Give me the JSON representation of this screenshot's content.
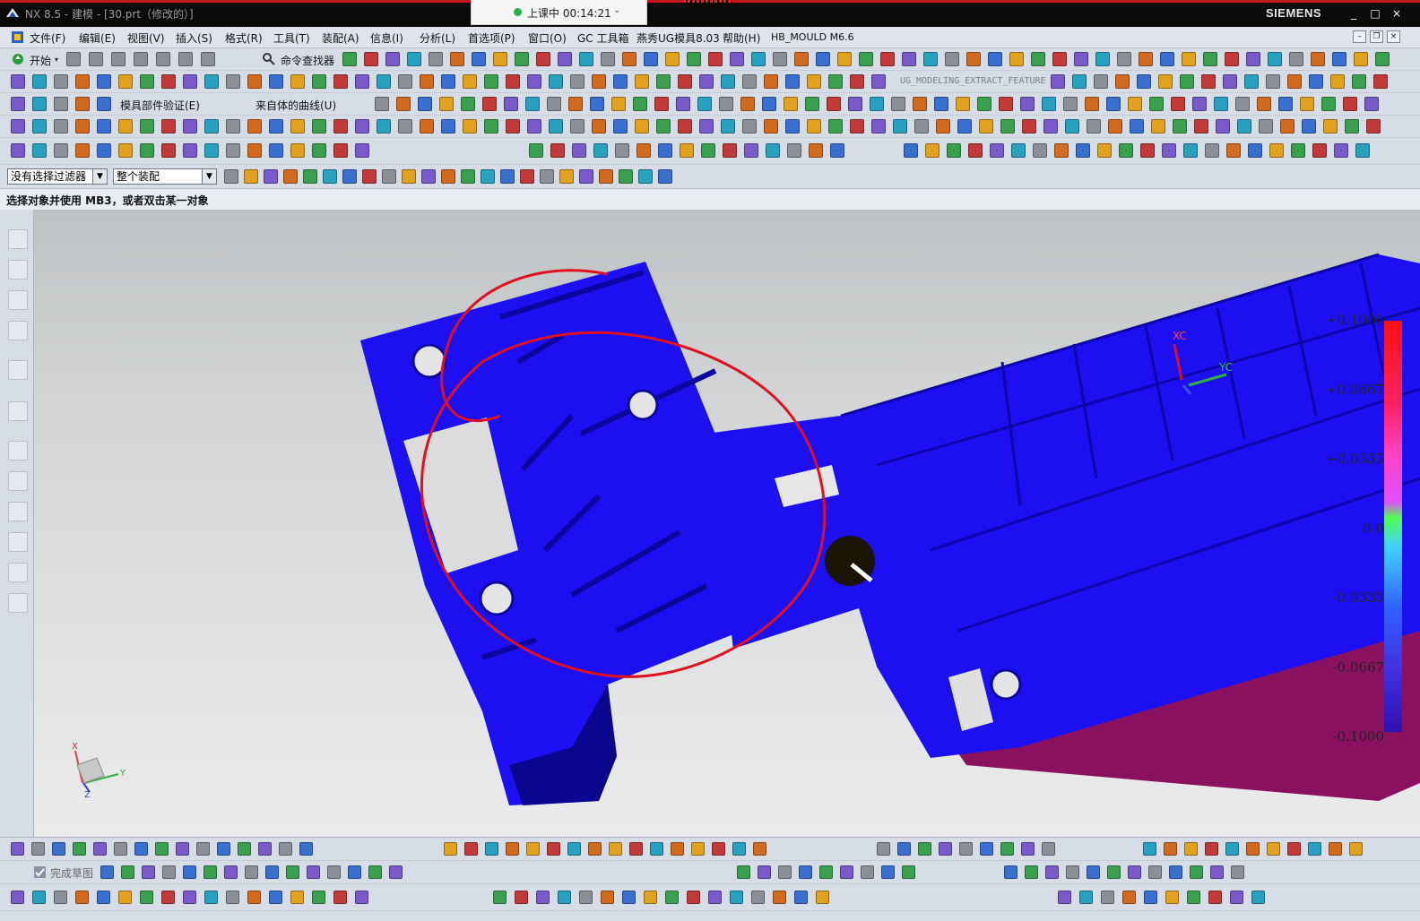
{
  "window": {
    "title": "NX 8.5 - 建模 - [30.prt（修改的）]",
    "brand": "SIEMENS",
    "controls": [
      "_",
      "□",
      "×"
    ]
  },
  "session_overlay": {
    "status": "上课中 00:14:21",
    "chevron": "⌄"
  },
  "menubar": {
    "items": [
      "文件(F)",
      "编辑(E)",
      "视图(V)",
      "插入(S)",
      "格式(R)",
      "工具(T)",
      "装配(A)",
      "信息(I)",
      "分析(L)",
      "首选项(P)",
      "窗口(O)",
      "GC 工具箱",
      "燕秀UG模具8.03",
      "帮助(H)",
      "HB_MOULD M6.6"
    ],
    "mdi_controls": [
      "–",
      "❐",
      "×"
    ]
  },
  "toolbar": {
    "start_label": "开始",
    "command_finder_label": "命令查找器",
    "extract_feature_label": "UG_MODELING_EXTRACT_FEATURE",
    "mold_validation_label": "模具部件验证(E)",
    "curves_from_bodies_label": "来自体的曲线(U)"
  },
  "selection_bar": {
    "filter_value": "没有选择过滤器",
    "scope_value": "整个装配"
  },
  "cue_line": {
    "text": "选择对象并使用 MB3，或者双击某一对象"
  },
  "viewport": {
    "scale_labels": [
      "+0.1000",
      "+0.0667",
      "+0.0333",
      "0.0",
      "-0.0333",
      "-0.0667",
      "-0.1000"
    ],
    "wcs_labels": {
      "xc": "XC",
      "yc": "YC"
    },
    "triad_labels": {
      "x": "X",
      "y": "Y",
      "z": "Z"
    },
    "model_color": "#1c10f2",
    "annotation_color": "#e01020"
  },
  "bottom_toolbar": {
    "finish_sketch_label": "完成草图"
  }
}
